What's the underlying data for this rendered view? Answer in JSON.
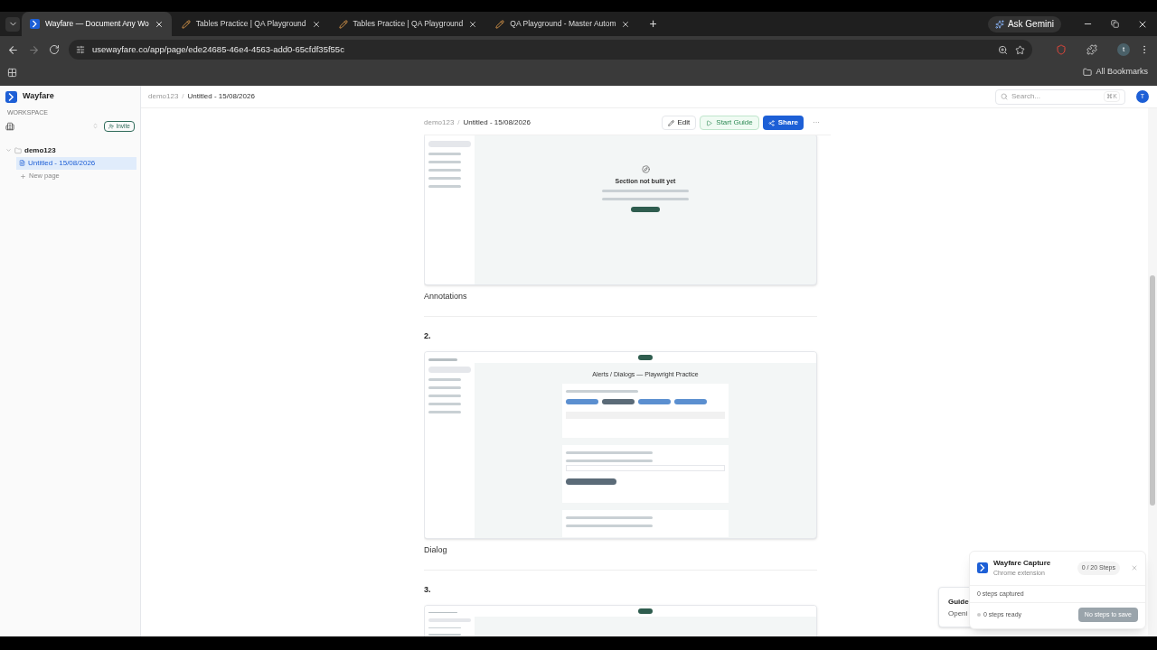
{
  "browser": {
    "tabs": [
      {
        "title": "Wayfare — Document Any Wo",
        "selected": true,
        "kind": "logo"
      },
      {
        "title": "Tables Practice | QA Playground",
        "selected": false,
        "kind": "pencil"
      },
      {
        "title": "Tables Practice | QA Playground",
        "selected": false,
        "kind": "pencil"
      },
      {
        "title": "QA Playground - Master Autom",
        "selected": false,
        "kind": "pencil"
      }
    ],
    "new_tab": "+",
    "ask": "Ask Gemini",
    "url": "usewayfare.co/app/page/ede24685-46e4-4563-add0-65cfdf35f55c",
    "bookmarks": "All Bookmarks",
    "profile": "t"
  },
  "sidebar": {
    "brand": "Wayfare",
    "workspace_label": "WORKSPACE",
    "invite": "Invite",
    "tree": [
      {
        "label": "demo123",
        "expanded": true,
        "children": [
          {
            "label": "Untitled - 15/08/2026",
            "selected": true
          }
        ]
      }
    ],
    "new_page": "New page"
  },
  "topbar": {
    "breadcrumb": [
      "demo123",
      "Untitled - 15/08/2026"
    ],
    "separator": "/",
    "search": {
      "placeholder": "Search..."
    },
    "shortcut": "⌘K",
    "avatar": "T"
  },
  "doc": {
    "breadcrumb": [
      "demo123",
      "Untitled - 15/08/2026"
    ],
    "separator": "/",
    "edit": "Edit",
    "guide": "Start Guide",
    "share": "Share",
    "more": "···",
    "steps": [
      {
        "kind": "empty-section",
        "heading": "Section not built yet",
        "caption": "Annotations"
      },
      {
        "kind": "dialogs",
        "number": "2.",
        "heading": "Alerts / Dialogs — Playwright Practice",
        "caption": "Dialog"
      },
      {
        "kind": "blank",
        "number": "3."
      }
    ]
  },
  "guide_card": {
    "title": "Guide",
    "text": "Openi"
  },
  "capture": {
    "title": "Wayfare Capture",
    "subtitle": "Chrome extension",
    "count": "0 / 20 Steps",
    "captured": "0 steps captured",
    "ready": "0 steps ready",
    "save": "No steps to save",
    "save_disabled": true
  }
}
